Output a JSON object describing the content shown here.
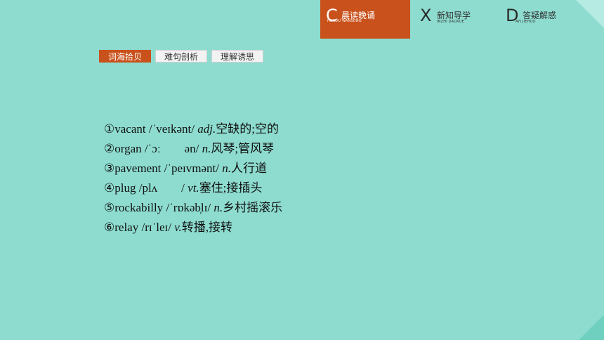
{
  "nav": {
    "active": {
      "letter": "C",
      "title": "晨读晚诵",
      "sub": "HENDU WANSONG"
    },
    "items": [
      {
        "letter": "X",
        "title": "新知导学",
        "sub": "INZHI DAOXUE"
      },
      {
        "letter": "D",
        "title": "答疑解惑",
        "sub": "AYI JIEHUO"
      }
    ]
  },
  "tabs": [
    "词海拾贝",
    "难句剖析",
    "理解诱思"
  ],
  "vocab": [
    {
      "marker": "①",
      "word": "vacant",
      "ipa": " /ˈveɪkənt/ ",
      "pos": "adj.",
      "meaning": "空缺的;空的"
    },
    {
      "marker": "②",
      "word": "organ",
      "ipa": " /ˈɔː        ən/ ",
      "pos": "n.",
      "meaning": "风琴;管风琴"
    },
    {
      "marker": "③",
      "word": "pavement",
      "ipa": " /ˈpeɪvmənt/ ",
      "pos": "n.",
      "meaning": "人行道"
    },
    {
      "marker": "④",
      "word": "plug",
      "ipa": " /plʌ        / ",
      "pos": "vt.",
      "meaning": "塞住;接插头"
    },
    {
      "marker": "⑤",
      "word": "rockabilly",
      "ipa": " /ˈrɒkəb̩lɪ/ ",
      "pos": "n.",
      "meaning": "乡村摇滚乐"
    },
    {
      "marker": "⑥",
      "word": "relay",
      "ipa": " /rɪˈleɪ/ ",
      "pos": "v.",
      "meaning": "转播,接转"
    }
  ]
}
